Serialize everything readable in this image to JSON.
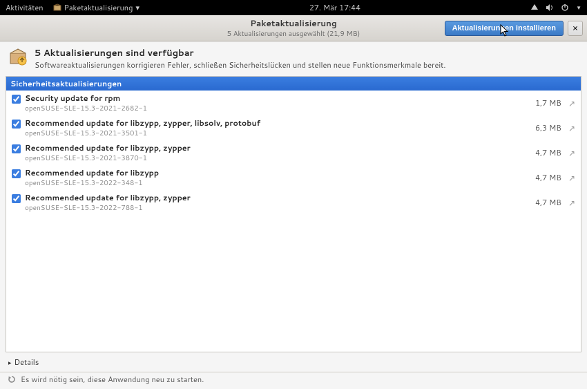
{
  "topbar": {
    "activities": "Aktivitäten",
    "app": "Paketaktualisierung",
    "datetime": "27. Mär  17:44"
  },
  "titlebar": {
    "title": "Paketaktualisierung",
    "subtitle": "5 Aktualisierungen ausgewählt (21,9 MB)",
    "install_label": "Aktualisierungen installieren",
    "close_glyph": "×"
  },
  "summary": {
    "heading": "5 Aktualisierungen sind verfügbar",
    "desc": "Softwareaktualisierungen korrigieren Fehler, schließen Sicherheitslücken und stellen neue Funktionsmerkmale bereit."
  },
  "category": {
    "label": "Sicherheitsaktualisierungen"
  },
  "updates": [
    {
      "name": "Security update for rpm",
      "pkg": "openSUSE-SLE-15.3-2021-2682-1",
      "size": "1,7 MB"
    },
    {
      "name": "Recommended update for libzypp, zypper, libsolv, protobuf",
      "pkg": "openSUSE-SLE-15.3-2021-3501-1",
      "size": "6,3 MB"
    },
    {
      "name": "Recommended update for libzypp, zypper",
      "pkg": "openSUSE-SLE-15.3-2021-3870-1",
      "size": "4,7 MB"
    },
    {
      "name": "Recommended update for libzypp",
      "pkg": "openSUSE-SLE-15.3-2022-348-1",
      "size": "4,7 MB"
    },
    {
      "name": "Recommended update for libzypp, zypper",
      "pkg": "openSUSE-SLE-15.3-2022-788-1",
      "size": "4,7 MB"
    }
  ],
  "details": {
    "label": "Details"
  },
  "footnote": {
    "text": "Es wird nötig sein, diese Anwendung neu zu starten."
  }
}
